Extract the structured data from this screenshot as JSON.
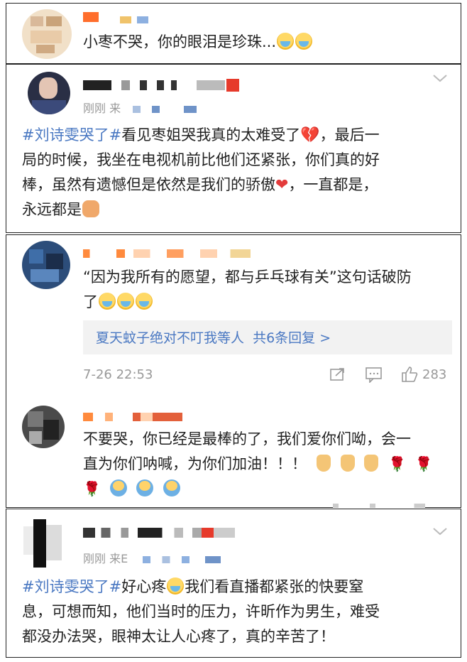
{
  "comment1": {
    "text": "小枣不哭，你的眼泪是珍珠..."
  },
  "comment2": {
    "meta_time": "刚刚 来",
    "hashtag": "#刘诗雯哭了#",
    "line1": "看见枣姐哭我真的太难受了",
    "line1b": "，最后一",
    "line2": "局的时候，我坐在电视机前比他们还紧张，你们真的好",
    "line3a": "棒，虽然有遗憾但是依然是我们的骄傲",
    "line3b": "，一直都是，",
    "line4": "永远都是"
  },
  "comment3": {
    "line1": "“因为我所有的愿望，都与乒乓球有关”这句话破防",
    "line2": "了",
    "reply_prefix": "夏天蚊子绝对不叮我等人",
    "reply_link": "共6条回复 >",
    "time": "7-26 22:53",
    "like_count": "283"
  },
  "comment4": {
    "line1": "不要哭，你已经是最棒的了，我们爱你们呦，会一",
    "line2": "直为你们呐喊，为你们加油！！！"
  },
  "comment5": {
    "meta_time": "刚刚 来E",
    "hashtag": "#刘诗雯哭了#",
    "line1": "好心疼",
    "line1b": "我们看直播都紧张的快要窒",
    "line2": "息，可想而知，他们当时的压力，许昕作为男生，难受",
    "line3": "都没办法哭，眼神太让人心疼了，真的辛苦了！"
  }
}
